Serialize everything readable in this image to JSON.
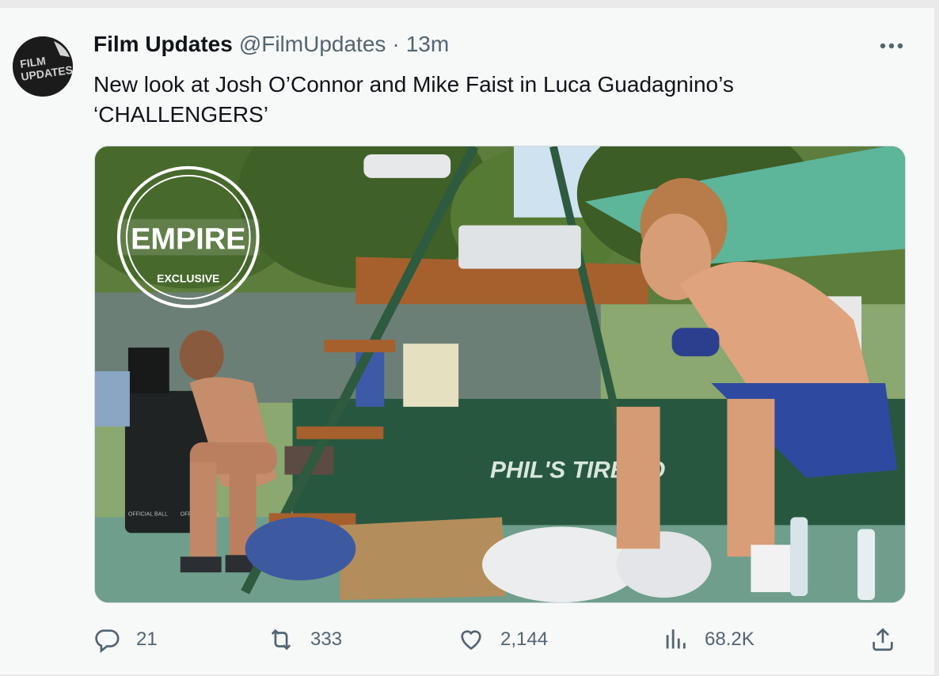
{
  "tweet": {
    "author_name": "Film Updates",
    "handle": "@FilmUpdates",
    "separator": "·",
    "timestamp": "13m",
    "text_lines": [
      "New look at Josh O’Connor and Mike Faist in Luca Guadagnino’s",
      "‘CHALLENGERS’"
    ]
  },
  "avatar": {
    "line1": "FILM",
    "line2": "UPDATES"
  },
  "media": {
    "watermark_main": "EMPIRE",
    "watermark_sub": "EXCLUSIVE",
    "banner_text": "PHIL'S TIRE TO",
    "bin_label_left": "OFFICIAL BALL",
    "bin_label_right": "OFFICIAL BALL"
  },
  "actions": {
    "replies": "21",
    "reposts": "333",
    "likes": "2,144",
    "views": "68.2K"
  },
  "icons": [
    "more-icon",
    "reply-icon",
    "repost-icon",
    "like-icon",
    "views-icon",
    "share-icon"
  ],
  "colors": {
    "text": "#0f1419",
    "secondary": "#536471",
    "background": "#f7f8f8"
  }
}
